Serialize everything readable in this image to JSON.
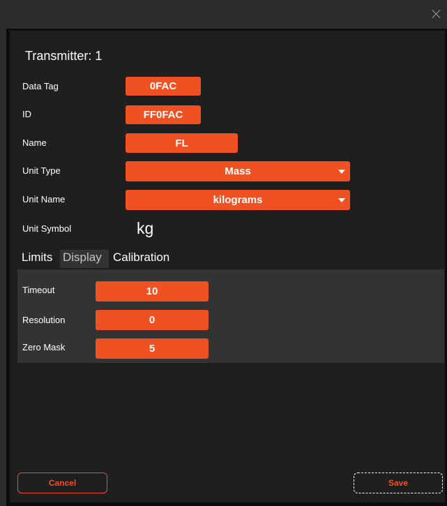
{
  "window": {
    "close_glyph": "close-icon"
  },
  "dialog": {
    "title": "Transmitter: 1"
  },
  "fields": {
    "data_tag": {
      "label": "Data Tag",
      "value": "0FAC"
    },
    "id": {
      "label": "ID",
      "value": "FF0FAC"
    },
    "name": {
      "label": "Name",
      "value": "FL"
    },
    "unit_type": {
      "label": "Unit Type",
      "value": "Mass"
    },
    "unit_name": {
      "label": "Unit Name",
      "value": "kilograms"
    },
    "unit_symbol": {
      "label": "Unit Symbol",
      "value": "kg"
    }
  },
  "tabs": [
    {
      "label": "Limits",
      "selected": false
    },
    {
      "label": "Display",
      "selected": true
    },
    {
      "label": "Calibration",
      "selected": false
    }
  ],
  "display": {
    "timeout": {
      "label": "Timeout",
      "value": "10"
    },
    "resolution": {
      "label": "Resolution",
      "value": "0"
    },
    "zero_mask": {
      "label": "Zero Mask",
      "value": "5"
    }
  },
  "buttons": {
    "cancel": "Cancel",
    "save": "Save"
  },
  "colors": {
    "accent": "#f05122",
    "background": "#1f1f1f",
    "tab_panel": "#333333"
  }
}
